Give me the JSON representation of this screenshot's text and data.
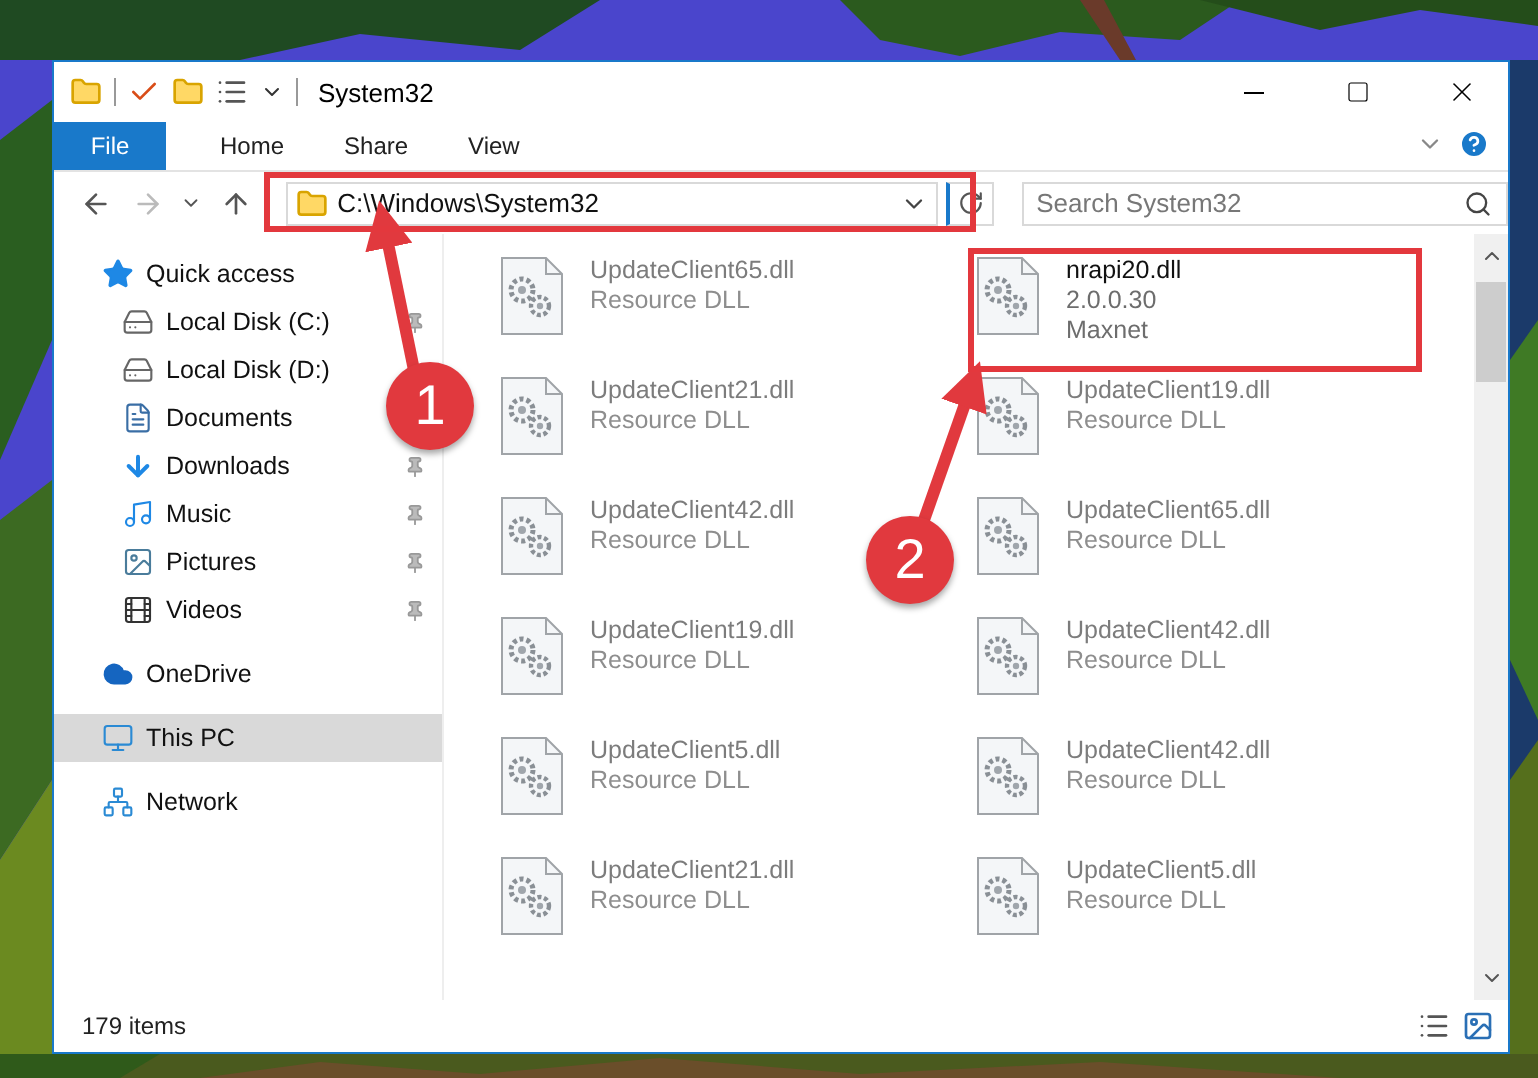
{
  "window": {
    "title": "System32"
  },
  "ribbon": {
    "file_button": "File",
    "tabs": [
      "Home",
      "Share",
      "View"
    ]
  },
  "address": {
    "path": "C:\\Windows\\System32"
  },
  "search": {
    "placeholder": "Search System32"
  },
  "nav": [
    {
      "label": "Quick access",
      "kind": "star",
      "selected": false,
      "children": [
        {
          "label": "Local Disk (C:)",
          "kind": "drive",
          "pinned": true,
          "selected": false
        },
        {
          "label": "Local Disk (D:)",
          "kind": "drive",
          "selected": false
        },
        {
          "label": "Documents",
          "kind": "document",
          "selected": false
        },
        {
          "label": "Downloads",
          "kind": "download",
          "pinned": true,
          "selected": false
        },
        {
          "label": "Music",
          "kind": "music",
          "pinned": true,
          "selected": false
        },
        {
          "label": "Pictures",
          "kind": "pictures",
          "pinned": true,
          "selected": false
        },
        {
          "label": "Videos",
          "kind": "videos",
          "pinned": true,
          "selected": false
        }
      ]
    },
    {
      "label": "OneDrive",
      "kind": "cloud",
      "selected": false
    },
    {
      "label": "This PC",
      "kind": "computer",
      "selected": true
    },
    {
      "label": "Network",
      "kind": "network",
      "selected": false
    }
  ],
  "files": [
    {
      "name": "UpdateClient65.dll",
      "lines": [
        "Resource DLL"
      ],
      "blurred": true
    },
    {
      "name": "nrapi20.dll",
      "lines": [
        "2.0.0.30",
        "Maxnet"
      ],
      "blurred": false
    },
    {
      "name": "UpdateClient21.dll",
      "lines": [
        "Resource DLL"
      ],
      "blurred": true
    },
    {
      "name": "UpdateClient19.dll",
      "lines": [
        "Resource DLL"
      ],
      "blurred": true
    },
    {
      "name": "UpdateClient42.dll",
      "lines": [
        "Resource DLL"
      ],
      "blurred": true
    },
    {
      "name": "UpdateClient65.dll",
      "lines": [
        "Resource DLL"
      ],
      "blurred": true
    },
    {
      "name": "UpdateClient19.dll",
      "lines": [
        "Resource DLL"
      ],
      "blurred": true
    },
    {
      "name": "UpdateClient42.dll",
      "lines": [
        "Resource DLL"
      ],
      "blurred": true
    },
    {
      "name": "UpdateClient5.dll",
      "lines": [
        "Resource DLL"
      ],
      "blurred": true
    },
    {
      "name": "UpdateClient42.dll",
      "lines": [
        "Resource DLL"
      ],
      "blurred": true
    },
    {
      "name": "UpdateClient21.dll",
      "lines": [
        "Resource DLL"
      ],
      "blurred": true
    },
    {
      "name": "UpdateClient5.dll",
      "lines": [
        "Resource DLL"
      ],
      "blurred": true
    }
  ],
  "status_bar": {
    "item_count": "179 items"
  },
  "callouts": [
    {
      "number": "1"
    },
    {
      "number": "2"
    }
  ]
}
